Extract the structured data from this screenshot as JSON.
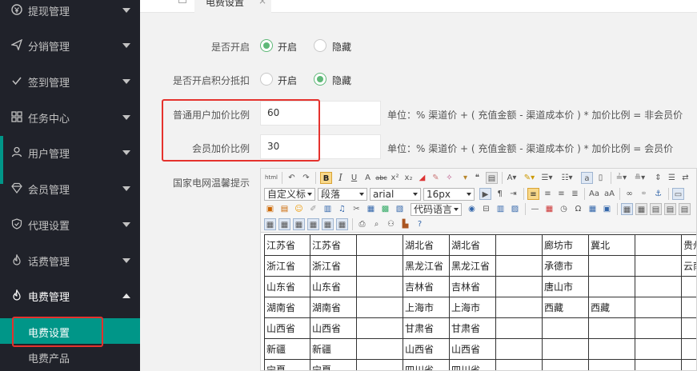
{
  "sidebar": {
    "items": [
      {
        "label": "提现管理",
        "icon": "withdraw-icon"
      },
      {
        "label": "分销管理",
        "icon": "send-icon"
      },
      {
        "label": "签到管理",
        "icon": "check-icon"
      },
      {
        "label": "任务中心",
        "icon": "grid-icon"
      },
      {
        "label": "用户管理",
        "icon": "user-icon"
      },
      {
        "label": "会员管理",
        "icon": "diamond-icon"
      },
      {
        "label": "代理设置",
        "icon": "shield-icon"
      },
      {
        "label": "话费管理",
        "icon": "fire-icon"
      },
      {
        "label": "电费管理",
        "icon": "fire-icon"
      }
    ],
    "sub_items": [
      {
        "label": "电费设置",
        "active": true
      },
      {
        "label": "电费产品",
        "active": false
      }
    ],
    "accent_color": "#009688"
  },
  "tabs": [
    {
      "label": "电费设置",
      "close": "×"
    }
  ],
  "form": {
    "enabled": {
      "label": "是否开启",
      "options": [
        "开启",
        "隐藏"
      ],
      "selected": "开启"
    },
    "points": {
      "label": "是否开启积分抵扣",
      "options": [
        "开启",
        "隐藏"
      ],
      "selected": "隐藏"
    },
    "normal_markup": {
      "label": "普通用户加价比例",
      "value": "60",
      "hint": "单位：%     渠道价 + ( 充值金额 - 渠道成本价 ) * 加价比例 = 非会员价"
    },
    "member_markup": {
      "label": "会员加价比例",
      "value": "30",
      "hint": "单位：%     渠道价 + ( 充值金额 - 渠道成本价 ) * 加价比例 = 会员价"
    },
    "notice": {
      "label": "国家电网温馨提示"
    }
  },
  "editor": {
    "custom_title": "自定义标",
    "paragraph": "段落",
    "font_family": "arial",
    "font_size": "16px",
    "code_lang": "代码语言",
    "rows": [
      [
        "江苏省",
        "江苏省",
        "",
        "湖北省",
        "湖北省",
        "",
        "廊坊市",
        "冀北",
        "",
        "贵州"
      ],
      [
        "浙江省",
        "浙江省",
        "",
        "黑龙江省",
        "黑龙江省",
        "",
        "承德市",
        "",
        "",
        "云南"
      ],
      [
        "山东省",
        "山东省",
        "",
        "吉林省",
        "吉林省",
        "",
        "唐山市",
        "",
        "",
        ""
      ],
      [
        "湖南省",
        "湖南省",
        "",
        "上海市",
        "上海市",
        "",
        "西藏",
        "西藏",
        "",
        ""
      ],
      [
        "山西省",
        "山西省",
        "",
        "甘肃省",
        "甘肃省",
        "",
        "",
        "",
        "",
        ""
      ],
      [
        "新疆",
        "新疆",
        "",
        "山西省",
        "山西省",
        "",
        "",
        "",
        "",
        ""
      ],
      [
        "宁夏",
        "宁夏",
        "",
        "四川省",
        "四川省",
        "",
        "",
        "",
        "",
        ""
      ]
    ]
  },
  "highlight_color": "#e5322d"
}
